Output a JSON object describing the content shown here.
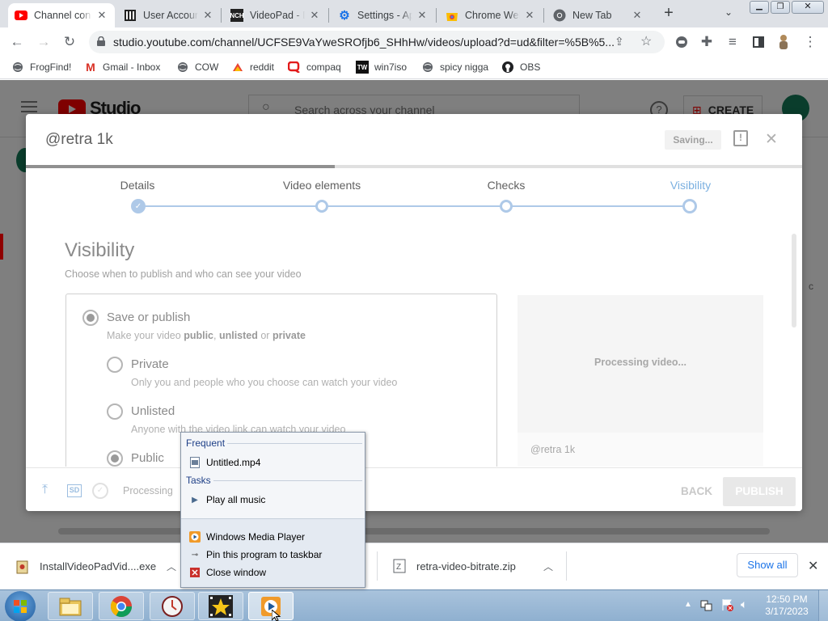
{
  "tabs": [
    {
      "title": "Channel con",
      "icon": "youtube-icon"
    },
    {
      "title": "User Accoun",
      "icon": "archive-icon"
    },
    {
      "title": "VideoPad - D",
      "icon": "nch-icon"
    },
    {
      "title": "Settings - Ap",
      "icon": "gear-icon"
    },
    {
      "title": "Chrome Web",
      "icon": "chrome-web-store-icon"
    },
    {
      "title": "New Tab",
      "icon": "chrome-icon"
    }
  ],
  "browser": {
    "url": "studio.youtube.com/channel/UCFSE9VaYweSROfjb6_SHhHw/videos/upload?d=ud&filter=%5B%5...",
    "new_tab_symbol": "+"
  },
  "bookmarks": [
    {
      "label": "FrogFind!"
    },
    {
      "label": "Gmail - Inbox"
    },
    {
      "label": "COW"
    },
    {
      "label": "reddit"
    },
    {
      "label": "compaq"
    },
    {
      "label": "win7iso"
    },
    {
      "label": "spicy nigga"
    },
    {
      "label": "OBS"
    }
  ],
  "studio": {
    "logo_text": "Studio",
    "search_placeholder": "Search across your channel",
    "create_label": "CREATE"
  },
  "dialog": {
    "title": "@retra 1k",
    "saving_label": "Saving...",
    "steps": [
      "Details",
      "Video elements",
      "Checks",
      "Visibility"
    ],
    "visibility_heading": "Visibility",
    "visibility_sub": "Choose when to publish and who can see your video",
    "save_publish_label": "Save or publish",
    "save_publish_desc_pre": "Make your video ",
    "save_publish_public": "public",
    "save_publish_comma": ", ",
    "save_publish_unlisted": "unlisted",
    "save_publish_or": " or ",
    "save_publish_private": "private",
    "private_label": "Private",
    "private_desc": "Only you and people who you choose can watch your video",
    "unlisted_label": "Unlisted",
    "unlisted_desc": "Anyone with the video link can watch your video",
    "public_label": "Public",
    "processing_video": "Processing video...",
    "channel_name": "@retra 1k",
    "footer_sd": "SD",
    "footer_processing": "Processing",
    "back_label": "BACK",
    "publish_label": "PUBLISH"
  },
  "downloads": {
    "file1": "InstallVideoPadVid....exe",
    "file2": "retra-video-bitrate.zip",
    "show_all": "Show all"
  },
  "jumplist": {
    "frequent_heading": "Frequent",
    "frequent_item": "Untitled.mp4",
    "tasks_heading": "Tasks",
    "task_item": "Play all music",
    "program": "Windows Media Player",
    "pin": "Pin this program to taskbar",
    "close": "Close window"
  },
  "clock": {
    "time": "12:50 PM",
    "date": "3/17/2023"
  },
  "colors": {
    "accent": "#065fd4",
    "step_blue": "#aec9e8",
    "youtube_red": "#ff0000"
  }
}
